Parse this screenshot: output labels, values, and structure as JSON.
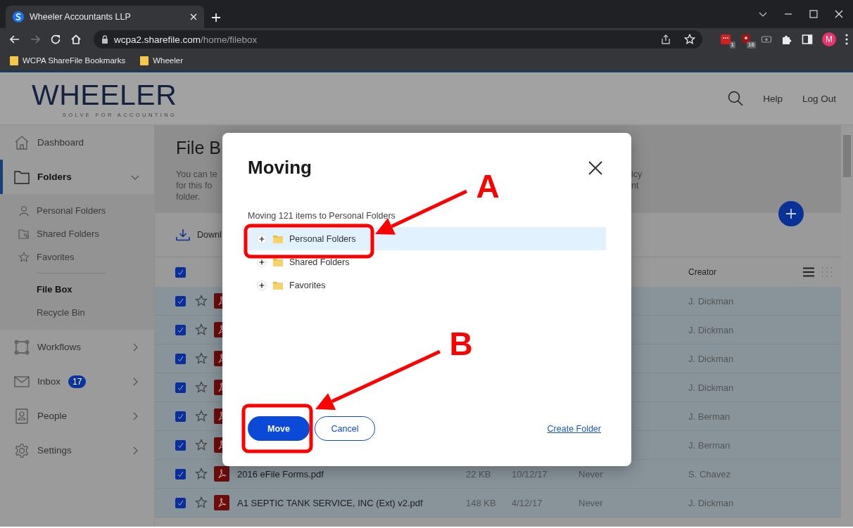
{
  "browser": {
    "tabs": [
      {
        "title": "Wheeler Accountants LLP",
        "selected": true
      }
    ],
    "nav_buttons": [
      {
        "kind": "back",
        "disabled": false
      },
      {
        "kind": "forward",
        "disabled": true
      },
      {
        "kind": "reload",
        "disabled": false
      },
      {
        "kind": "home",
        "disabled": false
      }
    ],
    "address": {
      "host": "wcpa2.sharefile.com",
      "path": "/home/filebox"
    },
    "extensions": [
      {
        "kind": "red",
        "badge": "1"
      },
      {
        "kind": "dark-red",
        "badge": "16"
      },
      {
        "kind": "ticket"
      },
      {
        "kind": "puzzle"
      },
      {
        "kind": "sidebar"
      }
    ],
    "profile": {
      "initial": "M"
    },
    "bookmarks": [
      {
        "label": "WCPA ShareFile Bookmarks"
      },
      {
        "label": "Wheeler"
      }
    ]
  },
  "header": {
    "logo": {
      "name": "WHEELER",
      "tagline": "SOLVE FOR ACCOUNTING"
    },
    "links": [
      "Help",
      "Log Out"
    ]
  },
  "sidebar": {
    "items": [
      {
        "label": "Dashboard",
        "selected": false
      },
      {
        "label": "Folders",
        "selected": true,
        "expanded": true,
        "children": [
          {
            "label": "Personal Folders",
            "selected": false
          },
          {
            "label": "Shared Folders",
            "selected": false
          },
          {
            "label": "Favorites",
            "selected": false
          },
          {
            "label": "File Box",
            "selected": true
          },
          {
            "label": "Recycle Bin",
            "selected": false
          }
        ]
      },
      {
        "label": "Workflows",
        "selected": false,
        "expanded": false
      },
      {
        "label": "Inbox",
        "selected": false,
        "expanded": false,
        "badge": "17"
      },
      {
        "label": "People",
        "selected": false,
        "expanded": false
      },
      {
        "label": "Settings",
        "selected": false,
        "expanded": false
      }
    ]
  },
  "main": {
    "title": "File B",
    "description_left": [
      "You can te",
      "for this fo",
      "folder."
    ],
    "description_right": [
      "icy",
      "nt"
    ],
    "toolbar": [
      "Downl"
    ],
    "table": {
      "header": {
        "checked": true,
        "columns": [
          "Creator"
        ]
      },
      "view_buttons": [
        {
          "kind": "list",
          "selected": true
        },
        {
          "kind": "grid",
          "selected": false
        }
      ],
      "rows": [
        {
          "checked": true,
          "selected": true,
          "creator": "J. Dickman"
        },
        {
          "checked": true,
          "selected": true,
          "creator": "J. Dickman"
        },
        {
          "checked": true,
          "selected": true,
          "creator": "J. Dickman"
        },
        {
          "checked": true,
          "selected": true,
          "creator": "J. Dickman"
        },
        {
          "checked": true,
          "selected": true,
          "creator": "J. Berman"
        },
        {
          "checked": true,
          "selected": true,
          "creator": "J. Berman"
        },
        {
          "checked": true,
          "selected": true,
          "name": "2016 eFile Forms.pdf",
          "size": "22 KB",
          "modified": "10/12/17",
          "expires": "Never",
          "creator": "S. Chavez"
        },
        {
          "checked": true,
          "selected": true,
          "name": "A1 SEPTIC TANK SERVICE, INC (Ext) v2.pdf",
          "size": "148 KB",
          "modified": "4/12/17",
          "expires": "Never",
          "creator": "J. Dickman"
        }
      ]
    }
  },
  "dialog": {
    "title": "Moving",
    "summary": "Moving 121 items to Personal Folders",
    "tree": [
      {
        "label": "Personal Folders",
        "selected": true,
        "expanded": false
      },
      {
        "label": "Shared Folders",
        "selected": false,
        "expanded": false
      },
      {
        "label": "Favorites",
        "selected": false,
        "expanded": false
      }
    ],
    "buttons": [
      {
        "label": "Move",
        "kind": "primary"
      },
      {
        "label": "Cancel",
        "kind": "secondary"
      }
    ],
    "link": "Create Folder"
  },
  "annotations": [
    {
      "label": "A"
    },
    {
      "label": "B"
    }
  ]
}
